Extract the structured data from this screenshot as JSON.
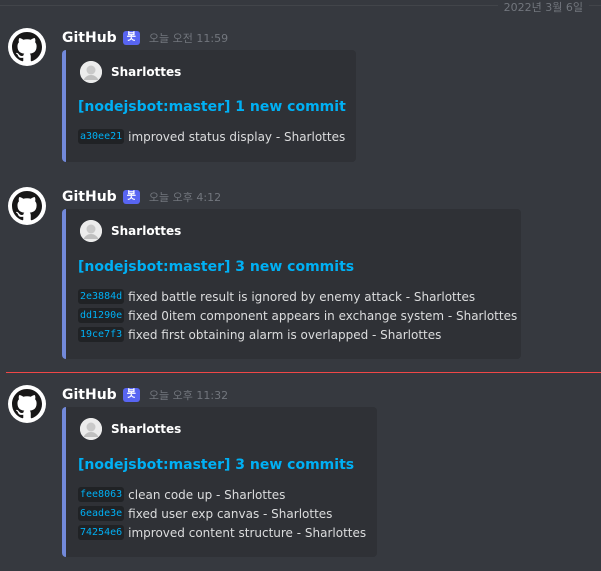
{
  "date_divider": "2022년 3월 6일",
  "messages": [
    {
      "author": "GitHub",
      "bot_tag": "봇",
      "timestamp": "오늘 오전 11:59",
      "embed": {
        "author_name": "Sharlottes",
        "title": "[nodejsbot:master] 1 new commit",
        "commits": [
          {
            "sha": "a30ee21",
            "message": "improved status display - Sharlottes"
          }
        ]
      }
    },
    {
      "author": "GitHub",
      "bot_tag": "봇",
      "timestamp": "오늘 오후 4:12",
      "embed": {
        "author_name": "Sharlottes",
        "title": "[nodejsbot:master] 3 new commits",
        "commits": [
          {
            "sha": "2e3884d",
            "message": "fixed battle result is ignored by enemy attack - Sharlottes"
          },
          {
            "sha": "dd1290e",
            "message": "fixed 0item component appears in exchange system - Sharlottes"
          },
          {
            "sha": "19ce7f3",
            "message": "fixed first obtaining alarm is overlapped - Sharlottes"
          }
        ]
      }
    },
    {
      "author": "GitHub",
      "bot_tag": "봇",
      "timestamp": "오늘 오후 11:32",
      "embed": {
        "author_name": "Sharlottes",
        "title": "[nodejsbot:master] 3 new commits",
        "commits": [
          {
            "sha": "fee8063",
            "message": "clean code up - Sharlottes"
          },
          {
            "sha": "6eade3e",
            "message": "fixed user exp canvas - Sharlottes"
          },
          {
            "sha": "74254e6",
            "message": "improved content structure - Sharlottes"
          }
        ]
      }
    }
  ]
}
